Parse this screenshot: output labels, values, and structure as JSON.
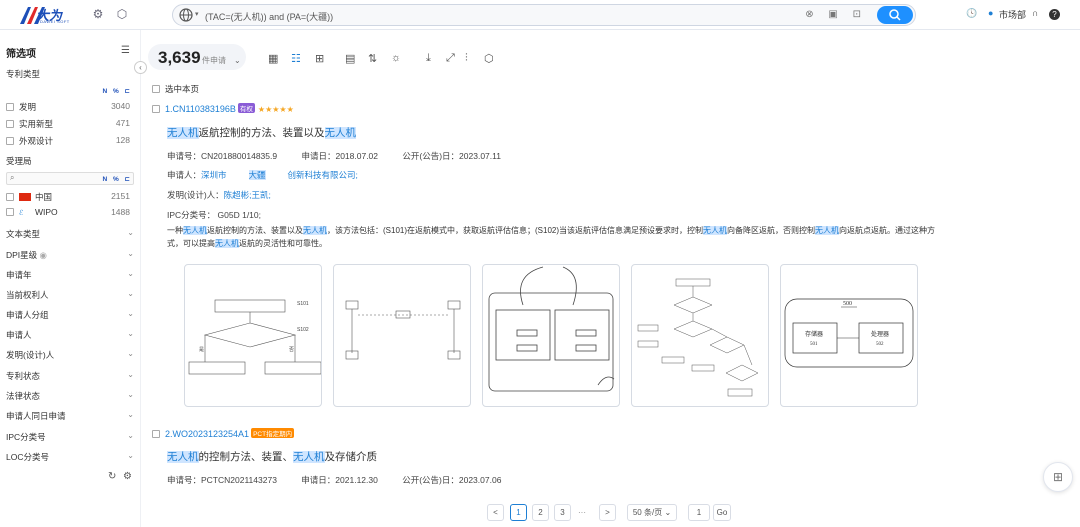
{
  "topbar": {
    "logo_text": "大为",
    "logo_sub": "DAWEI SOFT",
    "search_query": "(TAC=(无人机)) and (PA=(大疆))",
    "user_label": "市场部"
  },
  "sidebar": {
    "title": "筛选项",
    "patent_type_label": "专利类型",
    "col_header": "N % ⊏",
    "patent_types": [
      {
        "label": "发明",
        "count": "3040"
      },
      {
        "label": "实用新型",
        "count": "471"
      },
      {
        "label": "外观设计",
        "count": "128"
      }
    ],
    "authority_label": "受理局",
    "authorities": [
      {
        "label": "中国",
        "count": "2151"
      },
      {
        "label": "WIPO",
        "count": "1488"
      }
    ],
    "groups": [
      "文本类型",
      "DPI星级",
      "申请年",
      "当前权利人",
      "申请人分组",
      "申请人",
      "发明(设计)人",
      "专利状态",
      "法律状态",
      "申请人同日申请",
      "IPC分类号",
      "LOC分类号"
    ]
  },
  "results": {
    "count": "3,639",
    "count_unit": "件申请",
    "select_page": "选中本页",
    "items": [
      {
        "id": "1.CN110383196B",
        "badge": "有权",
        "title_parts": [
          [
            "无人机",
            true
          ],
          [
            "返航控制的方法、装置以及",
            false
          ],
          [
            "无人机",
            true
          ]
        ],
        "app_no": "申请号：CN201880014835.9",
        "app_date": "申请日：2018.07.02",
        "pub_date": "公开(公告)日：2023.07.11",
        "applicant_label": "申请人：",
        "applicant_pre": "深圳市",
        "applicant_hl": "大疆",
        "applicant_post": "创新科技有限公司;",
        "inventor_label": "发明(设计)人：",
        "inventor": "陈超彬;王凯;",
        "ipc": "IPC分类号：  G05D 1/10;",
        "abstract_parts": [
          [
            "一种",
            false
          ],
          [
            "无人机",
            true
          ],
          [
            "返航控制的方法、装置以及",
            false
          ],
          [
            "无人机",
            true
          ],
          [
            "，该方法包括：(S101)在返航模式中，获取返航评估信息；(S102)当该返航评估信息满足预设要求时，控制",
            false
          ],
          [
            "无人机",
            true
          ],
          [
            "向备降区返航，否则控制",
            false
          ],
          [
            "无人机",
            true
          ],
          [
            "向返航点返航。通过这种方式，可以提高",
            false
          ],
          [
            "无人机",
            true
          ],
          [
            "返航的灵活性和可靠性。",
            false
          ]
        ],
        "thumb_labels": [
          "S101",
          "S102",
          "是",
          "否",
          "500",
          "存储器",
          "501",
          "处理器",
          "502"
        ]
      },
      {
        "id": "2.WO2023123254A1",
        "badge": "PCT指定期内",
        "title_parts": [
          [
            "无人机",
            true
          ],
          [
            "的控制方法、装置、",
            false
          ],
          [
            "无人机",
            true
          ],
          [
            "及存储介质",
            false
          ]
        ],
        "app_no": "申请号：PCTCN2021143273",
        "app_date": "申请日：2021.12.30",
        "pub_date": "公开(公告)日：2023.07.06"
      }
    ]
  },
  "pagination": {
    "prev": "<",
    "pages": [
      "1",
      "2",
      "3"
    ],
    "ellipsis": "···",
    "next": ">",
    "page_size": "50 条/页",
    "jump_value": "1",
    "go_label": "Go"
  }
}
